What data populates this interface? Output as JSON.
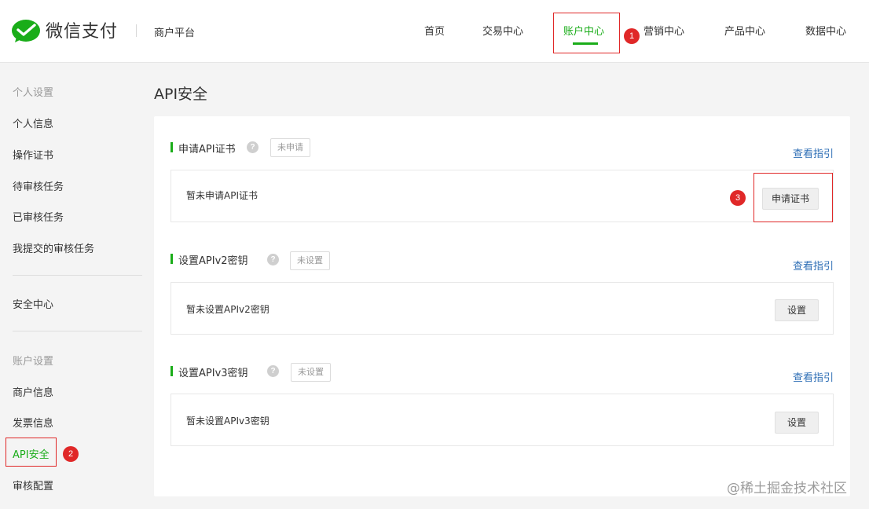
{
  "brand": {
    "name": "微信支付",
    "platform": "商户平台"
  },
  "nav": {
    "items": [
      "首页",
      "交易中心",
      "账户中心",
      "营销中心",
      "产品中心",
      "数据中心"
    ]
  },
  "annotations": [
    "1",
    "2",
    "3"
  ],
  "sidebar": {
    "group1": "个人设置",
    "group1_items": [
      "个人信息",
      "操作证书",
      "待审核任务",
      "已审核任务",
      "我提交的审核任务"
    ],
    "security": "安全中心",
    "group2": "账户设置",
    "group2_items": [
      "商户信息",
      "发票信息",
      "API安全",
      "审核配置"
    ]
  },
  "page": {
    "title": "API安全"
  },
  "sections": [
    {
      "title": "申请API证书",
      "status": "未申请",
      "guide": "查看指引",
      "empty_text": "暂未申请API证书",
      "button": "申请证书"
    },
    {
      "title": "设置APIv2密钥",
      "status": "未设置",
      "guide": "查看指引",
      "empty_text": "暂未设置APIv2密钥",
      "button": "设置"
    },
    {
      "title": "设置APIv3密钥",
      "status": "未设置",
      "guide": "查看指引",
      "empty_text": "暂未设置APIv3密钥",
      "button": "设置"
    }
  ],
  "icons": {
    "help": "?"
  },
  "watermark": "@稀土掘金技术社区",
  "colors": {
    "accent": "#1aad19",
    "link": "#2f6fb6",
    "highlight": "#e02828"
  }
}
